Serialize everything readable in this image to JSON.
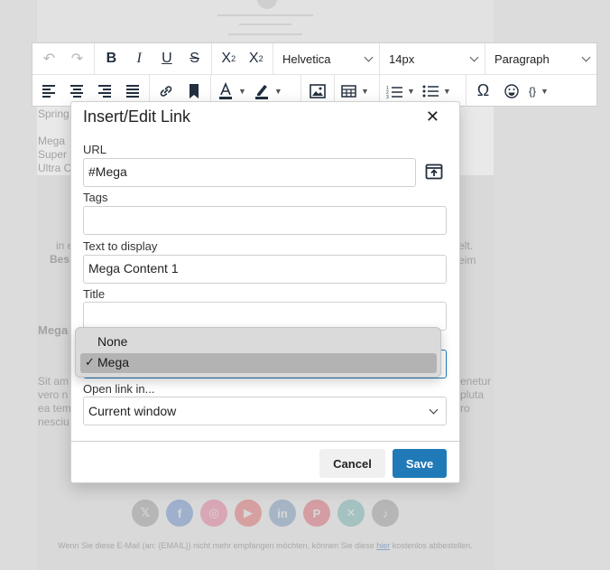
{
  "background": {
    "lines_left": [
      "Spring",
      "Mega",
      "Super",
      "Ultra C"
    ],
    "para1_left": "in e",
    "para1_right": "elt.",
    "para2_left": "Bes",
    "para2_right": "eim",
    "heading_left": "Mega",
    "para3_left": [
      "Sit am",
      "vero n",
      "ea tem",
      "nesciu"
    ],
    "para3_right": [
      "enetur",
      "pluta",
      "ro"
    ],
    "social_icons": [
      "x-icon",
      "facebook-icon",
      "instagram-icon",
      "youtube-icon",
      "linkedin-icon",
      "pinterest-icon",
      "xing-icon",
      "tiktok-icon"
    ],
    "social_colors": [
      "#b6b6b6",
      "#9fb0cc",
      "#d9a6b5",
      "#d6a0a0",
      "#a6b5c6",
      "#d49da3",
      "#a3c2c0",
      "#b6b6b6"
    ],
    "footer_text": "Wenn Sie diese E-Mail (an: {EMAIL}) nicht mehr empfangen möchten, können Sie diese",
    "footer_link": "hier",
    "footer_tail": "kostenlos abbestellen."
  },
  "toolbar": {
    "font_family": "Helvetica",
    "font_size": "14px",
    "block_format": "Paragraph"
  },
  "dialog": {
    "title": "Insert/Edit Link",
    "url_label": "URL",
    "url_value": "#Mega",
    "tags_label": "Tags",
    "tags_value": "",
    "text_label": "Text to display",
    "text_value": "Mega Content 1",
    "title_label": "Title",
    "title_value": "",
    "open_label": "Open link in...",
    "open_value": "Current window",
    "cancel_label": "Cancel",
    "save_label": "Save",
    "accent": "#207ab7"
  },
  "dropdown": {
    "options": [
      "None",
      "Mega"
    ],
    "selected": "Mega",
    "check_glyph": "✓"
  }
}
